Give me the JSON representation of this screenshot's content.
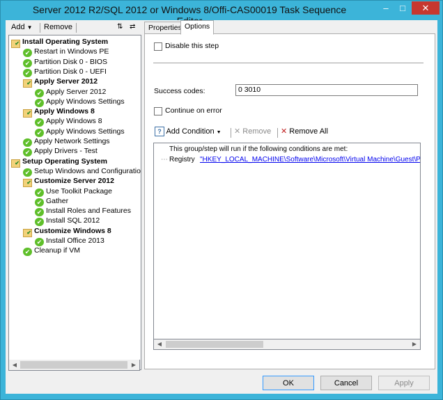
{
  "window": {
    "title": "Server 2012 R2/SQL 2012 or Windows 8/Offi-CAS00019 Task Sequence Editor"
  },
  "toolbar": {
    "add_label": "Add",
    "remove_label": "Remove"
  },
  "tree": [
    {
      "label": "Install Operating System",
      "type": "group",
      "level": 0
    },
    {
      "label": "Restart in Windows PE",
      "type": "step",
      "level": 1
    },
    {
      "label": "Partition Disk 0 - BIOS",
      "type": "step",
      "level": 1
    },
    {
      "label": "Partition Disk 0 - UEFI",
      "type": "step",
      "level": 1
    },
    {
      "label": "Apply Server 2012",
      "type": "group",
      "level": 1
    },
    {
      "label": "Apply Server 2012",
      "type": "step",
      "level": 2
    },
    {
      "label": "Apply Windows Settings",
      "type": "step",
      "level": 2
    },
    {
      "label": "Apply Windows 8",
      "type": "group",
      "level": 1
    },
    {
      "label": "Apply Windows 8",
      "type": "step",
      "level": 2
    },
    {
      "label": "Apply Windows Settings",
      "type": "step",
      "level": 2
    },
    {
      "label": "Apply Network Settings",
      "type": "step",
      "level": 1
    },
    {
      "label": "Apply Drivers - Test",
      "type": "step",
      "level": 1
    },
    {
      "label": "Setup Operating System",
      "type": "group",
      "level": 0
    },
    {
      "label": "Setup Windows and Configuration",
      "type": "step",
      "level": 1
    },
    {
      "label": "Customize Server 2012",
      "type": "group",
      "level": 1
    },
    {
      "label": "Use Toolkit Package",
      "type": "step",
      "level": 2
    },
    {
      "label": "Gather",
      "type": "step",
      "level": 2
    },
    {
      "label": "Install Roles and Features",
      "type": "step",
      "level": 2
    },
    {
      "label": "Install SQL 2012",
      "type": "step",
      "level": 2
    },
    {
      "label": "Customize Windows 8",
      "type": "group",
      "level": 1
    },
    {
      "label": "Install Office 2013",
      "type": "step",
      "level": 2
    },
    {
      "label": "Cleanup if VM",
      "type": "step",
      "level": 1
    }
  ],
  "tabs": [
    {
      "label": "Properties"
    },
    {
      "label": "Options"
    }
  ],
  "options": {
    "disable_label": "Disable this step",
    "success_codes_label": "Success codes:",
    "success_codes_value": "0 3010",
    "continue_label": "Continue on error",
    "add_condition_label": "Add Condition",
    "remove_label": "Remove",
    "remove_all_label": "Remove All",
    "condition_header": "This group/step will run if the following conditions are met:",
    "condition_type": "Registry",
    "condition_value": "\"HKEY_LOCAL_MACHINE\\Software\\Microsoft\\Virtual Machine\\Guest\\Par"
  },
  "buttons": {
    "ok": "OK",
    "cancel": "Cancel",
    "apply": "Apply"
  },
  "colors": {
    "title_bar": "#3cb4d9",
    "close_button": "#c7372f",
    "check_green": "#5fbf2a",
    "link_blue": "#0000ee"
  }
}
